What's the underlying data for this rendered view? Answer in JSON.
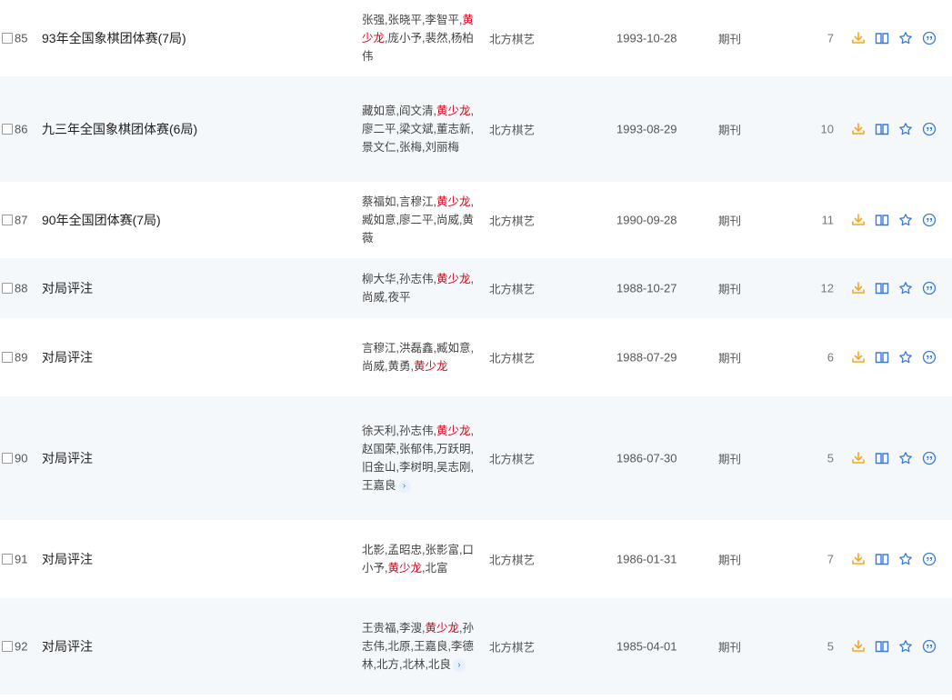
{
  "rows": [
    {
      "num": "85",
      "title": "93年全国象棋团体赛(7局)",
      "authors": [
        {
          "t": "张强,张晓平,李智平,",
          "h": false
        },
        {
          "t": "黄少龙",
          "h": true
        },
        {
          "t": ",庞小予,裴然,杨柏伟",
          "h": false
        }
      ],
      "more": false,
      "source": "北方棋艺",
      "date": "1993-10-28",
      "type": "期刊",
      "count": "7"
    },
    {
      "num": "86",
      "title": "九三年全国象棋团体赛(6局)",
      "authors": [
        {
          "t": "藏如意,阎文清,",
          "h": false
        },
        {
          "t": "黄少龙",
          "h": true
        },
        {
          "t": ",廖二平,梁文斌,董志新,景文仁,张梅,刘丽梅",
          "h": false
        }
      ],
      "more": false,
      "source": "北方棋艺",
      "date": "1993-08-29",
      "type": "期刊",
      "count": "10"
    },
    {
      "num": "87",
      "title": "90年全国团体赛(7局)",
      "authors": [
        {
          "t": "蔡福如,言穆江,",
          "h": false
        },
        {
          "t": "黄少龙",
          "h": true
        },
        {
          "t": ",臧如意,廖二平,尚威,黄薇",
          "h": false
        }
      ],
      "more": false,
      "source": "北方棋艺",
      "date": "1990-09-28",
      "type": "期刊",
      "count": "11"
    },
    {
      "num": "88",
      "title": "对局评注",
      "authors": [
        {
          "t": "柳大华,孙志伟,",
          "h": false
        },
        {
          "t": "黄少龙",
          "h": true
        },
        {
          "t": ",尚威,夜平",
          "h": false
        }
      ],
      "more": false,
      "source": "北方棋艺",
      "date": "1988-10-27",
      "type": "期刊",
      "count": "12"
    },
    {
      "num": "89",
      "title": "对局评注",
      "authors": [
        {
          "t": "言穆江,洪磊鑫,臧如意,尚威,黄勇,",
          "h": false
        },
        {
          "t": "黄少龙",
          "h": true
        }
      ],
      "more": false,
      "source": "北方棋艺",
      "date": "1988-07-29",
      "type": "期刊",
      "count": "6"
    },
    {
      "num": "90",
      "title": "对局评注",
      "authors": [
        {
          "t": "徐天利,孙志伟,",
          "h": false
        },
        {
          "t": "黄少龙",
          "h": true
        },
        {
          "t": ",赵国荣,张郁伟,万跃明,旧金山,李树明,吴志刚,王嘉良",
          "h": false
        }
      ],
      "more": true,
      "source": "北方棋艺",
      "date": "1986-07-30",
      "type": "期刊",
      "count": "5"
    },
    {
      "num": "91",
      "title": "对局评注",
      "authors": [
        {
          "t": "北影,孟昭忠,张影富,口小予,",
          "h": false
        },
        {
          "t": "黄少龙",
          "h": true
        },
        {
          "t": ",北富",
          "h": false
        }
      ],
      "more": false,
      "source": "北方棋艺",
      "date": "1986-01-31",
      "type": "期刊",
      "count": "7"
    },
    {
      "num": "92",
      "title": "对局评注",
      "authors": [
        {
          "t": "王贵福,李溲,",
          "h": false
        },
        {
          "t": "黄少龙",
          "h": true
        },
        {
          "t": ",孙志伟,北原,王嘉良,李德林,北方,北林,北良",
          "h": false
        }
      ],
      "more": true,
      "source": "北方棋艺",
      "date": "1985-04-01",
      "type": "期刊",
      "count": "5"
    }
  ],
  "icons": [
    "download-icon",
    "read-icon",
    "favorite-icon",
    "cite-icon"
  ],
  "colors": {
    "highlight": "#d0021b",
    "download": "#f5a623",
    "action": "#3a7bd5",
    "row_alt": "#f5f8fb"
  }
}
